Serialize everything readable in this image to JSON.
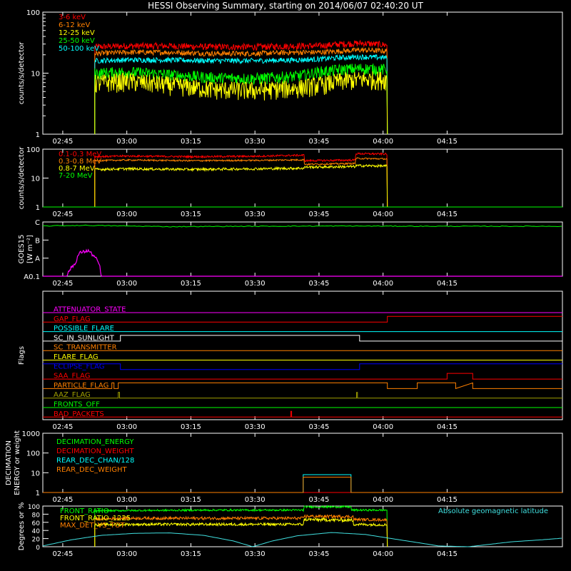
{
  "title": "HESSI Observing Summary, starting on 2014/06/07 02:40:20 UT",
  "colors": {
    "background": "#000000",
    "axes": "#ffffff",
    "red": "#ff0000",
    "orange": "#ff8000",
    "yellow": "#ffff00",
    "green": "#00ff00",
    "cyan": "#00ffff",
    "blue": "#0000ff",
    "magenta": "#ff00ff",
    "olive": "#a0a000",
    "lightcyan": "#40e0e0"
  },
  "x_axis": {
    "start": "02:40:20",
    "end": "04:22",
    "range_min": [
      40.333,
      162
    ],
    "tick_labels": [
      "02:45",
      "03:00",
      "03:15",
      "03:30",
      "03:45",
      "04:00",
      "04:15"
    ],
    "tick_values_min": [
      45,
      60,
      75,
      90,
      105,
      120,
      135
    ]
  },
  "chart_data": [
    {
      "id": "lightcurves",
      "type": "line",
      "ylabel": "counts/s/detector",
      "yscale": "log",
      "ylim": [
        1,
        100
      ],
      "ytick_labels": [
        "1",
        "10",
        "100"
      ],
      "legend_position": "top-left",
      "data_start_min": 52.5,
      "data_end_min": 121,
      "series": [
        {
          "name": "3-6 keV",
          "color": "#ff0000",
          "x": [
            52.5,
            60,
            70,
            80,
            90,
            100,
            105,
            110,
            115,
            121
          ],
          "y": [
            27,
            28,
            28,
            27,
            27,
            28,
            28,
            30,
            31,
            29
          ]
        },
        {
          "name": "6-12 keV",
          "color": "#ff8000",
          "x": [
            52.5,
            60,
            70,
            80,
            90,
            100,
            105,
            110,
            115,
            121
          ],
          "y": [
            21,
            22,
            22,
            21,
            21,
            22,
            22,
            23,
            24,
            23
          ]
        },
        {
          "name": "12-25 keV",
          "color": "#ffff00",
          "x": [
            52.5,
            60,
            70,
            80,
            90,
            100,
            105,
            110,
            115,
            121
          ],
          "y": [
            7,
            7.5,
            6.5,
            5.5,
            5.3,
            5.8,
            6.5,
            7.5,
            8,
            8
          ]
        },
        {
          "name": "25-50 keV",
          "color": "#00ff00",
          "x": [
            52.5,
            60,
            70,
            80,
            90,
            100,
            105,
            110,
            115,
            121
          ],
          "y": [
            10,
            10.5,
            9.5,
            8.5,
            8.2,
            9,
            10.5,
            11.5,
            12,
            11.5
          ]
        },
        {
          "name": "50-100 keV",
          "color": "#00ffff",
          "x": [
            52.5,
            60,
            70,
            80,
            90,
            100,
            105,
            110,
            115,
            121
          ],
          "y": [
            16,
            16.5,
            16.5,
            16,
            16,
            16.5,
            17,
            18,
            18.5,
            18
          ]
        }
      ]
    },
    {
      "id": "high_energy",
      "type": "line",
      "ylabel": "counts/s/detector",
      "yscale": "log",
      "ylim": [
        1,
        100
      ],
      "ytick_labels": [
        "1",
        "10",
        "100"
      ],
      "legend_position": "top-left",
      "data_start_min": 52.5,
      "data_end_min": 121,
      "series": [
        {
          "name": "0.1-0.3 MeV",
          "color": "#ff0000",
          "x": [
            52.5,
            60,
            75,
            90,
            101.5,
            101.6,
            113.5,
            113.6,
            121
          ],
          "y": [
            55,
            58,
            55,
            57,
            62,
            40,
            42,
            70,
            68
          ]
        },
        {
          "name": "0.3-0.8 MeV",
          "color": "#ff8000",
          "x": [
            52.5,
            60,
            75,
            90,
            101.5,
            101.6,
            113.5,
            113.6,
            121
          ],
          "y": [
            40,
            42,
            40,
            41,
            43,
            30,
            32,
            48,
            46
          ]
        },
        {
          "name": "0.8-7 MeV",
          "color": "#ffff00",
          "x": [
            52.5,
            60,
            75,
            90,
            101.5,
            101.6,
            113.5,
            113.6,
            121
          ],
          "y": [
            20,
            21,
            20,
            21,
            22,
            24,
            25,
            27,
            26
          ]
        },
        {
          "name": "7-20 MeV",
          "color": "#00ff00",
          "x": [
            40.333,
            162
          ],
          "y": [
            1,
            1
          ]
        }
      ]
    },
    {
      "id": "goes",
      "type": "line",
      "ylabel": "GOES15",
      "yunit": "[W m⁻²]",
      "ytick_labels": [
        "A0.1",
        "A",
        "B",
        "C"
      ],
      "ylevels": [
        0.1,
        1,
        10,
        100
      ],
      "series": [
        {
          "name": "GOES low",
          "color": "#00ff00",
          "x": [
            40.333,
            50,
            70,
            90,
            110,
            130,
            162
          ],
          "y": [
            60,
            65,
            55,
            58,
            60,
            58,
            58
          ]
        },
        {
          "name": "GOES high",
          "color": "#ff00ff",
          "x": [
            40.333,
            46,
            48,
            49,
            51,
            52,
            54,
            162
          ],
          "y": [
            0.1,
            0.1,
            0.5,
            2,
            2.6,
            1.5,
            0.1,
            0.1
          ]
        }
      ]
    },
    {
      "id": "flags",
      "type": "line",
      "ylabel": "Flags",
      "flags": [
        {
          "name": "ATTENUATOR_STATE",
          "color": "#ff00ff",
          "x": [
            40.333,
            162
          ],
          "y": [
            0,
            0
          ]
        },
        {
          "name": "GAP_FLAG",
          "color": "#ff0000",
          "x": [
            40.333,
            121,
            121,
            162
          ],
          "y": [
            0,
            0,
            1,
            1
          ]
        },
        {
          "name": "POSSIBLE_FLARE",
          "color": "#00ffff",
          "x": [
            40.333,
            162
          ],
          "y": [
            0,
            0
          ]
        },
        {
          "name": "SC_IN_SUNLIGHT",
          "color": "#ffffff",
          "x": [
            40.333,
            58.5,
            58.5,
            114.5,
            114.5,
            162
          ],
          "y": [
            0,
            0,
            1,
            1,
            0,
            0
          ]
        },
        {
          "name": "SC_TRANSMITTER",
          "color": "#ff8000",
          "x": [
            40.333,
            162
          ],
          "y": [
            0,
            0
          ]
        },
        {
          "name": "FLARE_FLAG",
          "color": "#ffff00",
          "x": [
            40.333,
            162
          ],
          "y": [
            0,
            0
          ]
        },
        {
          "name": "ECLIPSE_FLAG",
          "color": "#0000ff",
          "x": [
            40.333,
            58.5,
            58.5,
            114.5,
            114.5,
            162
          ],
          "y": [
            1,
            1,
            0,
            0,
            1,
            1
          ]
        },
        {
          "name": "SAA_FLAG",
          "color": "#ff0000",
          "x": [
            40.333,
            135,
            135,
            141,
            141,
            162
          ],
          "y": [
            0,
            0,
            1,
            1,
            0,
            0
          ]
        },
        {
          "name": "PARTICLE_FLAG",
          "color": "#ff8000",
          "x": [
            40.333,
            56.5,
            56.5,
            57,
            57,
            58,
            58,
            121,
            121,
            128,
            128,
            137,
            137,
            141,
            141,
            162
          ],
          "y": [
            0,
            0,
            1,
            1,
            0,
            0,
            1,
            1,
            0,
            0,
            1,
            1,
            0,
            1,
            0,
            0
          ]
        },
        {
          "name": "AAZ_FLAG",
          "color": "#a0a000",
          "x": [
            40.333,
            58,
            58,
            58.3,
            58.3,
            113.8,
            113.8,
            114,
            114,
            162
          ],
          "y": [
            0,
            0,
            1,
            1,
            0,
            0,
            1,
            1,
            0,
            0
          ]
        },
        {
          "name": "FRONTS_OFF",
          "color": "#00ff00",
          "x": [
            40.333,
            162
          ],
          "y": [
            0,
            0
          ]
        },
        {
          "name": "BAD_PACKETS",
          "color": "#ff0000",
          "x": [
            40.333,
            98.4,
            98.4,
            98.6,
            98.6,
            162
          ],
          "y": [
            0,
            0,
            1,
            1,
            0,
            0
          ]
        }
      ]
    },
    {
      "id": "decimation",
      "type": "line",
      "ylabel": "DECIMATION ENERGY or weight",
      "yscale": "log",
      "ylim": [
        1,
        1000
      ],
      "ytick_labels": [
        "1",
        "10",
        "100",
        "1000"
      ],
      "legend_position": "top-left",
      "series": [
        {
          "name": "DECIMATION_ENERGY",
          "color": "#00ff00",
          "x": [
            40.333,
            162
          ],
          "y": [
            1,
            1
          ]
        },
        {
          "name": "DECIMATION_WEIGHT",
          "color": "#ff0000",
          "x": [
            40.333,
            162
          ],
          "y": [
            1,
            1
          ]
        },
        {
          "name": "REAR_DEC_CHAN/128",
          "color": "#00ffff",
          "x": [
            40.333,
            101.3,
            101.3,
            112.5,
            112.5,
            162
          ],
          "y": [
            1,
            1,
            8,
            8,
            1,
            1
          ]
        },
        {
          "name": "REAR_DEC_WEIGHT",
          "color": "#ff8000",
          "x": [
            40.333,
            101.3,
            101.3,
            112.5,
            112.5,
            162
          ],
          "y": [
            1,
            1,
            6,
            6,
            1,
            1
          ]
        }
      ]
    },
    {
      "id": "ratios",
      "type": "line",
      "ylabel": "Degrees or %",
      "ylim": [
        0,
        100
      ],
      "ytick_labels": [
        "0",
        "20",
        "40",
        "60",
        "80",
        "100"
      ],
      "legend_position": "top-left",
      "series": [
        {
          "name": "FRONT_RATIO",
          "color": "#00ff00",
          "x": [
            52.5,
            60,
            80,
            101.4,
            101.5,
            112.5,
            112.6,
            121
          ],
          "y": [
            88,
            89,
            90,
            90,
            98,
            98,
            90,
            90
          ]
        },
        {
          "name": "FRONT_RATIO_1225",
          "color": "#ffff00",
          "x": [
            52.5,
            60,
            80,
            101.4,
            101.5,
            113,
            113.1,
            121
          ],
          "y": [
            54,
            55,
            55,
            55,
            67,
            65,
            55,
            54
          ]
        },
        {
          "name": "MAX_DET_VS_TOT",
          "color": "#ff8000",
          "x": [
            52.5,
            60,
            80,
            101.4,
            101.5,
            113,
            113.1,
            121
          ],
          "y": [
            68,
            70,
            70,
            70,
            75,
            74,
            67,
            66
          ]
        },
        {
          "name": "Absolute geomagnetic latitude",
          "color": "#40e0e0",
          "x": [
            40.333,
            47,
            54,
            62,
            70,
            78,
            85,
            89.5,
            94,
            100,
            108,
            116,
            122,
            127,
            133,
            140,
            150,
            157,
            162
          ],
          "y": [
            2,
            17,
            28,
            33,
            34,
            28,
            14,
            0,
            14,
            27,
            35,
            30,
            20,
            12,
            2,
            0,
            12,
            17,
            21
          ]
        }
      ]
    }
  ]
}
